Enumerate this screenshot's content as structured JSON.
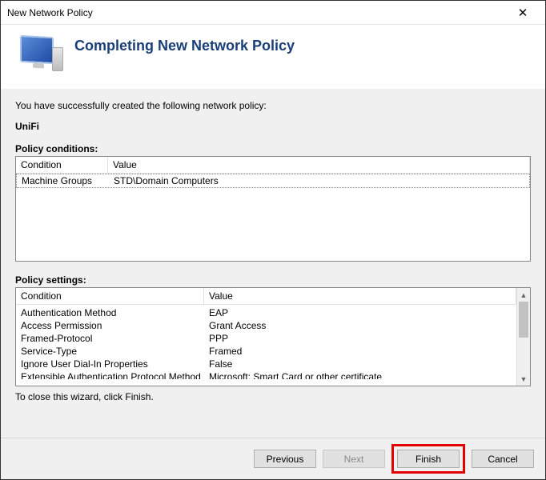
{
  "window": {
    "title": "New Network Policy"
  },
  "header": {
    "title": "Completing New Network Policy"
  },
  "intro": "You have successfully created the following network policy:",
  "policy_name": "UniFi",
  "conditions": {
    "label": "Policy conditions:",
    "headers": {
      "c1": "Condition",
      "c2": "Value"
    },
    "rows": [
      {
        "condition": "Machine Groups",
        "value": "STD\\Domain Computers"
      }
    ]
  },
  "settings": {
    "label": "Policy settings:",
    "headers": {
      "c1": "Condition",
      "c2": "Value"
    },
    "rows": [
      {
        "condition": "Authentication Method",
        "value": "EAP"
      },
      {
        "condition": "Access Permission",
        "value": "Grant Access"
      },
      {
        "condition": "Framed-Protocol",
        "value": "PPP"
      },
      {
        "condition": "Service-Type",
        "value": "Framed"
      },
      {
        "condition": "Ignore User Dial-In Properties",
        "value": "False"
      },
      {
        "condition": "Extensible Authentication Protocol Method",
        "value": "Microsoft: Smart Card or other certificate"
      }
    ]
  },
  "hint": "To close this wizard, click Finish.",
  "buttons": {
    "previous": "Previous",
    "next": "Next",
    "finish": "Finish",
    "cancel": "Cancel"
  }
}
